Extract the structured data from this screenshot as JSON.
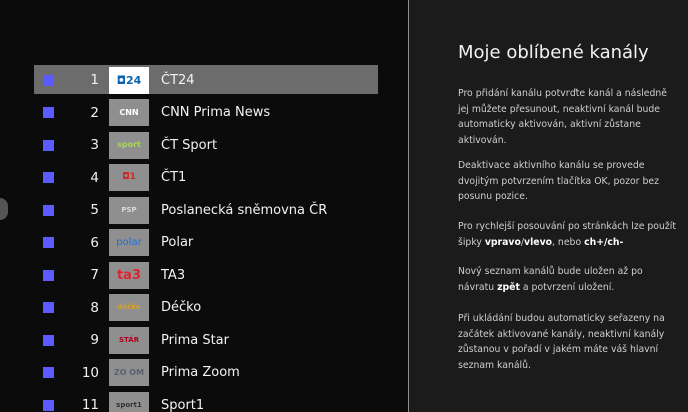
{
  "channels": [
    {
      "number": "1",
      "name": "ČT24",
      "logo": "◘24",
      "selected": true
    },
    {
      "number": "2",
      "name": "CNN Prima News",
      "logo": "CNN",
      "selected": false
    },
    {
      "number": "3",
      "name": "ČT Sport",
      "logo": "sport",
      "selected": false
    },
    {
      "number": "4",
      "name": "ČT1",
      "logo": "◘1",
      "selected": false
    },
    {
      "number": "5",
      "name": "Poslanecká sněmovna ČR",
      "logo": "PSP",
      "selected": false
    },
    {
      "number": "6",
      "name": "Polar",
      "logo": "polar",
      "selected": false
    },
    {
      "number": "7",
      "name": "TA3",
      "logo": "ta3",
      "selected": false
    },
    {
      "number": "8",
      "name": "Déčko",
      "logo": "déčko",
      "selected": false
    },
    {
      "number": "9",
      "name": "Prima Star",
      "logo": "STÁR",
      "selected": false
    },
    {
      "number": "10",
      "name": "Prima Zoom",
      "logo": "ZO OM",
      "selected": false
    },
    {
      "number": "11",
      "name": "Sport1",
      "logo": "sport1",
      "selected": false
    }
  ],
  "help": {
    "title": "Moje oblíbené kanály",
    "p1": "Pro přidání kanálu potvrďte kanál a následně jej můžete přesunout, neaktivní kanál bude automaticky aktivován, aktivní zůstane aktivován.",
    "p2": "Deaktivace aktivního kanálu se provede dvojitým potvrzením tlačítka OK, pozor bez posunu pozice.",
    "p3_a": "Pro rychlejší posouvání po stránkách lze použít šipky ",
    "p3_b": "vpravo",
    "p3_c": "/",
    "p3_d": "vlevo",
    "p3_e": ", nebo ",
    "p3_f": "ch+",
    "p3_g": "/",
    "p3_h": "ch-",
    "p4_a": "Nový seznam kanálů bude uložen až po návratu ",
    "p4_b": "zpět",
    "p4_c": " a potvrzení uložení.",
    "p5": "Při ukládání budou automaticky seřazeny na začátek aktivované kanály, neaktivní kanály zůstanou v pořadí v jakém máte váš hlavní seznam kanálů."
  },
  "colors": {
    "checkbox": "#5b5bff",
    "selected_row": "#6c6c6c",
    "panel_bg": "#1b1b1b",
    "background": "#0b0b0b"
  }
}
